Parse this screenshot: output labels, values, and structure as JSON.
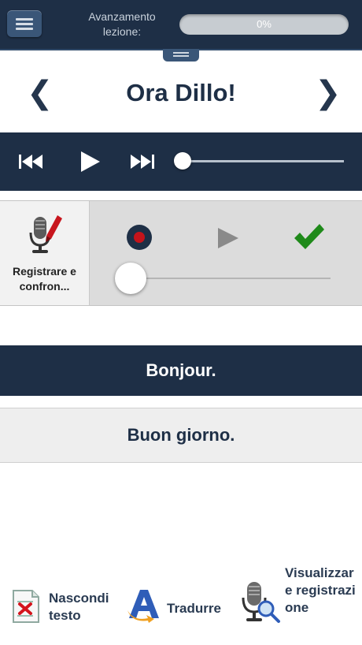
{
  "header": {
    "progress_label": "Avanzamento lezione:",
    "progress_text": "0%",
    "progress_value": 0
  },
  "nav": {
    "title": "Ora Dillo!",
    "prev_glyph": "❮",
    "next_glyph": "❯"
  },
  "player": {
    "position": 0,
    "icons": [
      "skip-back-icon",
      "play-icon",
      "skip-forward-icon"
    ]
  },
  "recorder": {
    "label": "Registrare e confron...",
    "position": 0,
    "icons": [
      "microphone-icon",
      "record-icon",
      "play-icon",
      "checkmark-icon"
    ],
    "colors": {
      "record": "#c4141b",
      "check": "#1f8a1a",
      "play": "#8a8a8a"
    }
  },
  "phrases": {
    "source": "Bonjour.",
    "translation": "Buon giorno."
  },
  "toolbar": {
    "hide_text_label": "Nascondi testo",
    "translate_label": "Tradurre",
    "view_recording_label": "Visualizzare registrazione"
  },
  "colors": {
    "navy": "#1e2f46",
    "accent": "#3a5678"
  }
}
